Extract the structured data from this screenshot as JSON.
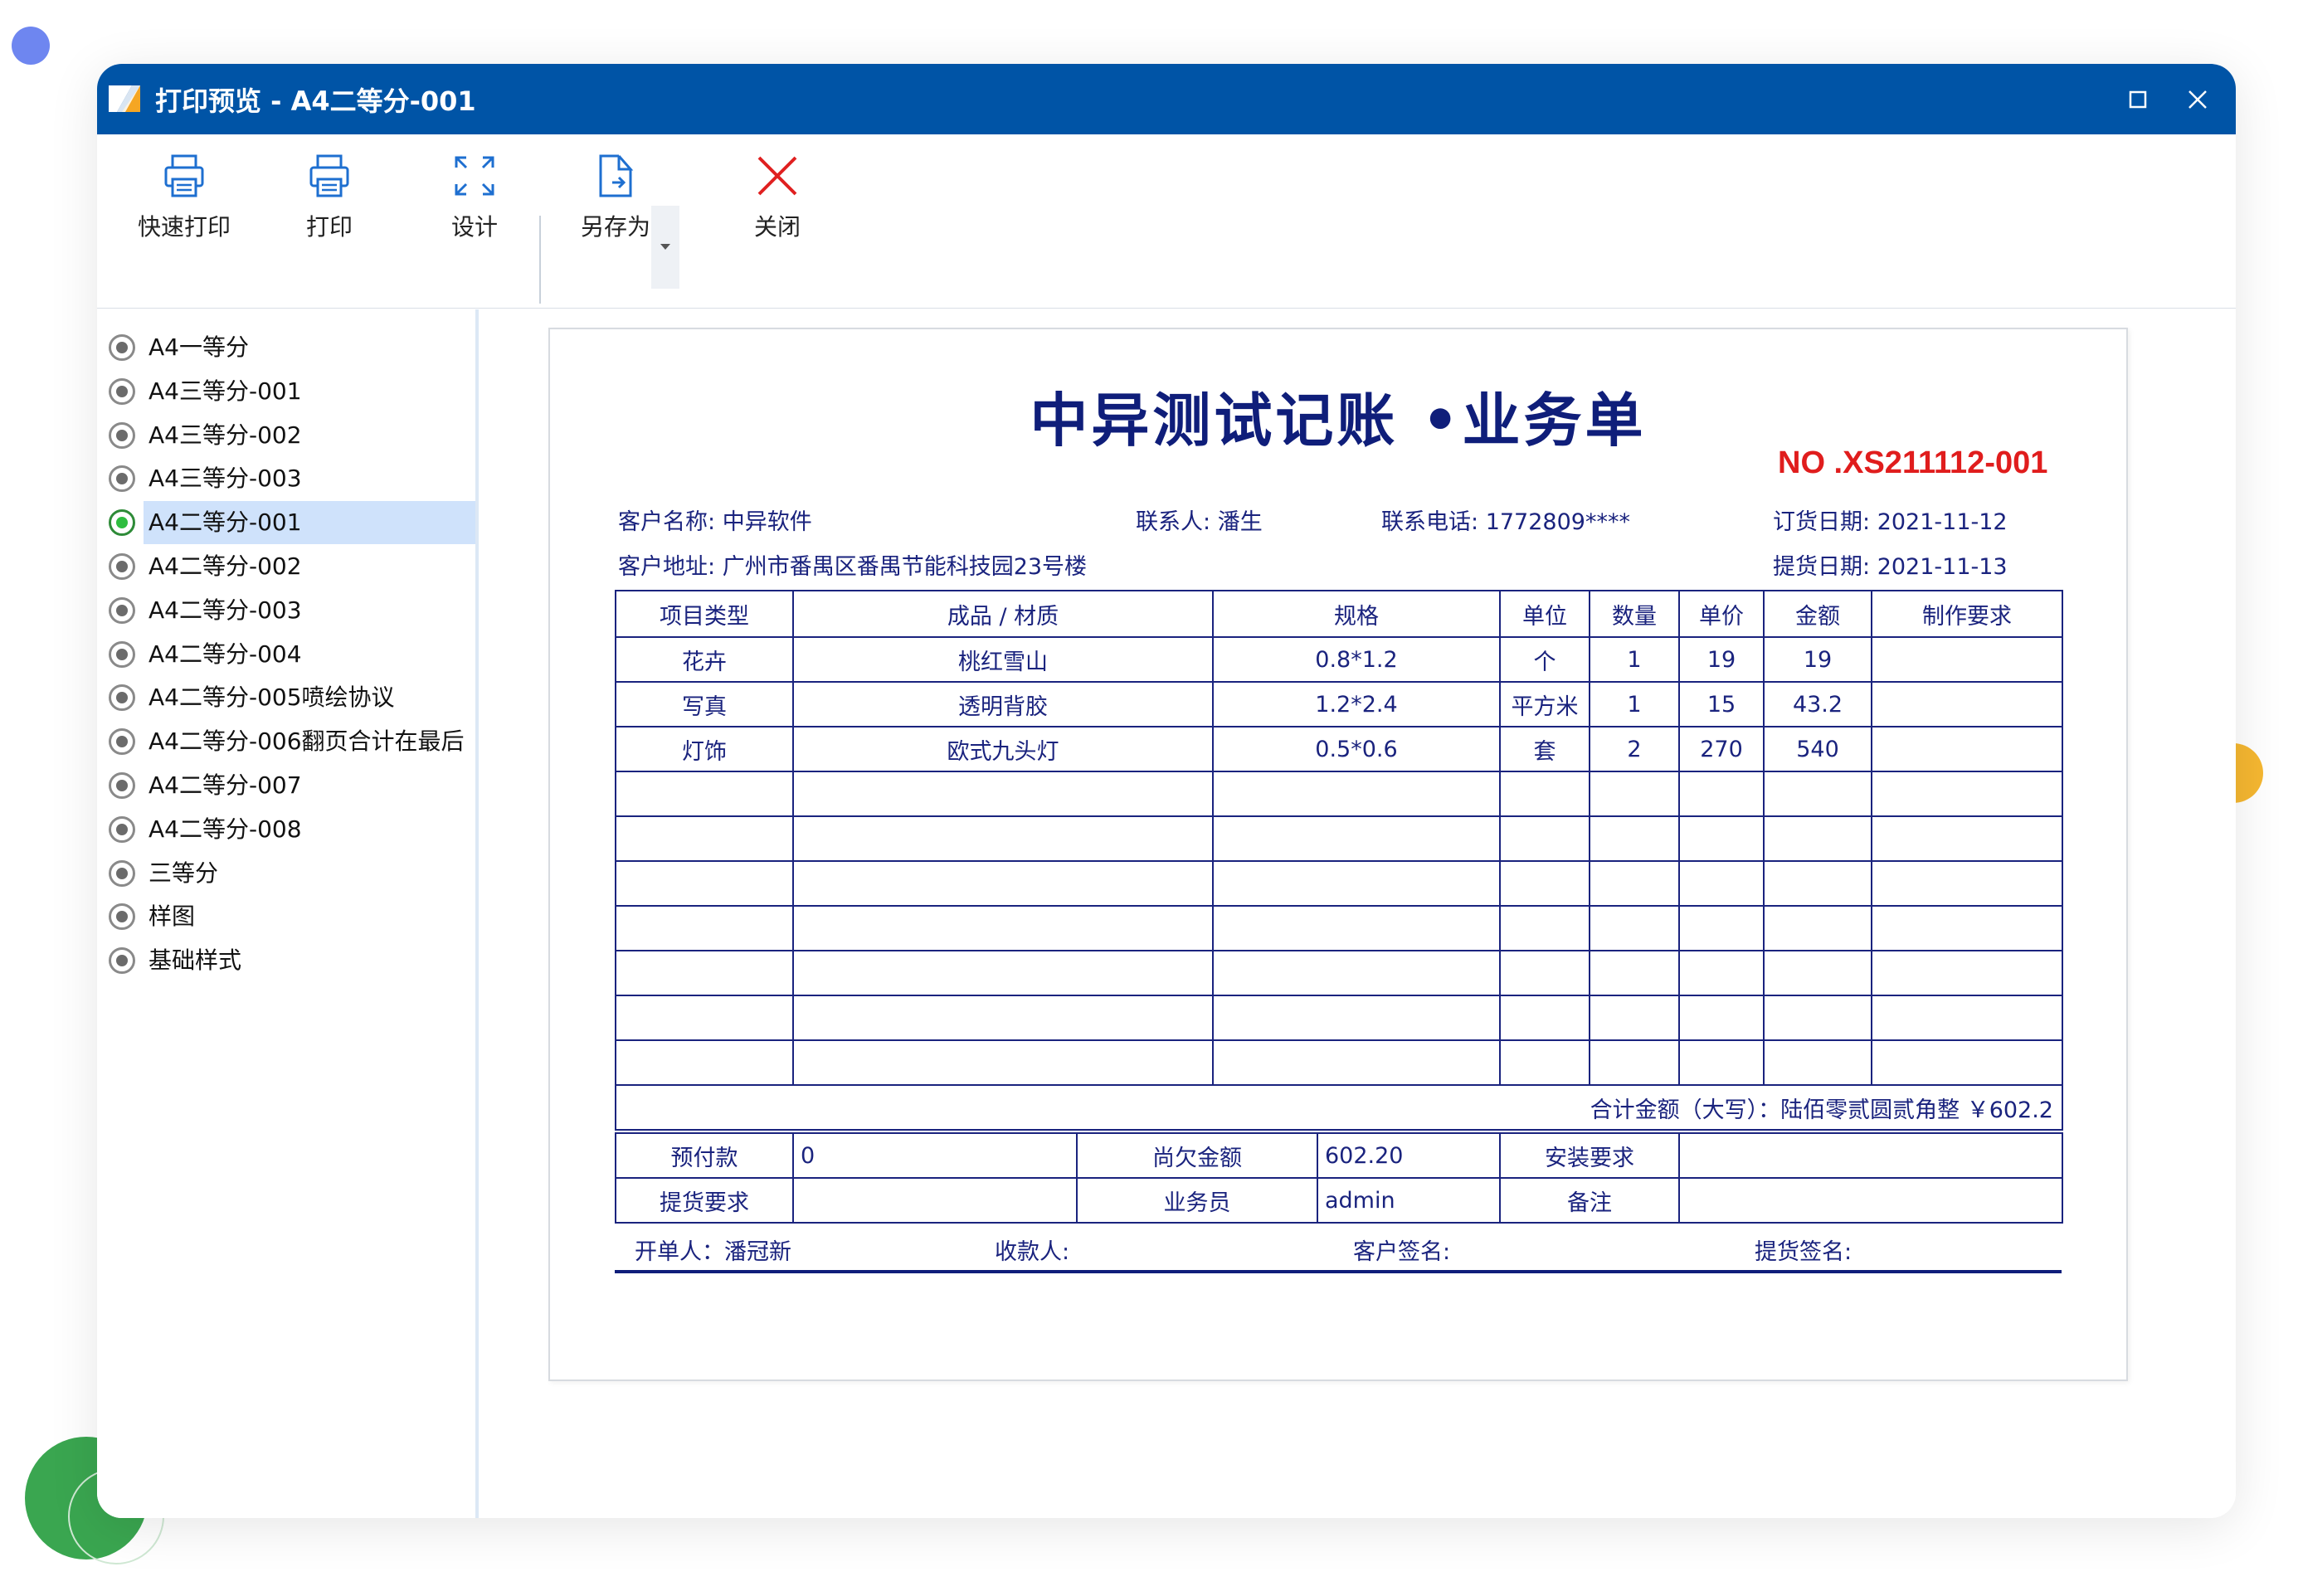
{
  "window": {
    "title": "打印预览 - A4二等分-001",
    "accent": "#0054a6"
  },
  "toolbar": {
    "quick_print": "快速打印",
    "print": "打印",
    "design": "设计",
    "save_as": "另存为",
    "close": "关闭"
  },
  "sidebar": {
    "items": [
      "A4一等分",
      "A4三等分-001",
      "A4三等分-002",
      "A4三等分-003",
      "A4二等分-001",
      "A4二等分-002",
      "A4二等分-003",
      "A4二等分-004",
      "A4二等分-005喷绘协议",
      "A4二等分-006翻页合计在最后",
      "A4二等分-007",
      "A4二等分-008",
      "三等分",
      "样图",
      "基础样式"
    ],
    "selected_index": 4
  },
  "document": {
    "title": "中异测试记账 •业务单",
    "number": "NO .XS211112-001",
    "customer_name_label": "客户名称:",
    "customer_name": "中异软件",
    "contact_label": "联系人:",
    "contact": "潘生",
    "phone_label": "联系电话:",
    "phone": "1772809****",
    "order_date_label": "订货日期:",
    "order_date": "2021-11-12",
    "address_label": "客户地址:",
    "address": "广州市番禺区番禺节能科技园23号楼",
    "pickup_date_label": "提货日期:",
    "pickup_date": "2021-11-13",
    "columns": [
      "项目类型",
      "成品 / 材质",
      "规格",
      "单位",
      "数量",
      "单价",
      "金额",
      "制作要求"
    ],
    "rows": [
      [
        "花卉",
        "桃红雪山",
        "0.8*1.2",
        "个",
        "1",
        "19",
        "19",
        ""
      ],
      [
        "写真",
        "透明背胶",
        "1.2*2.4",
        "平方米",
        "1",
        "15",
        "43.2",
        ""
      ],
      [
        "灯饰",
        "欧式九头灯",
        "0.5*0.6",
        "套",
        "2",
        "270",
        "540",
        ""
      ]
    ],
    "empty_rows": 7,
    "total_text": "合计金额（大写）：陆佰零贰圆贰角整 ￥602.2",
    "prepay_label": "预付款",
    "prepay": "0",
    "owed_label": "尚欠金额",
    "owed": "602.20",
    "install_label": "安装要求",
    "install": "",
    "pickup_req_label": "提货要求",
    "pickup_req": "",
    "salesman_label": "业务员",
    "salesman": "admin",
    "remark_label": "备注",
    "remark": "",
    "issuer": "开单人：潘冠新",
    "payee": "收款人:",
    "customer_sign": "客户签名:",
    "pickup_sign": "提货签名:"
  }
}
